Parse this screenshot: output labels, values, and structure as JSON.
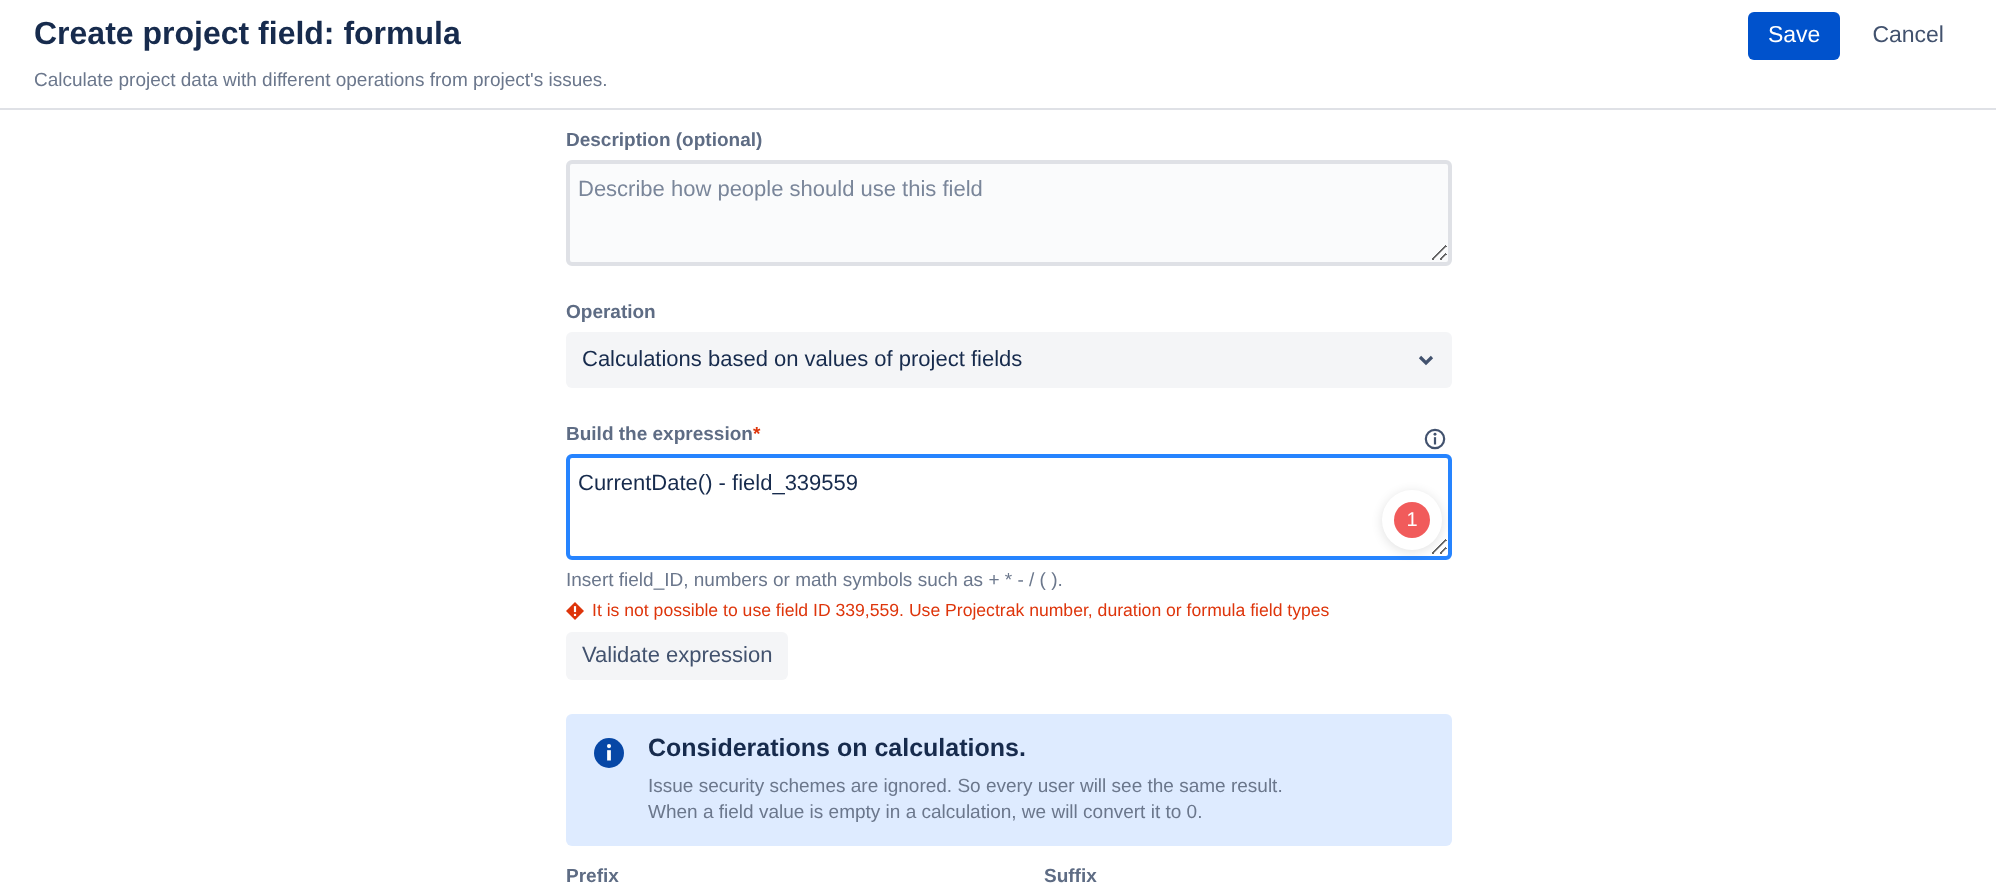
{
  "header": {
    "title": "Create project field: formula",
    "subtitle": "Calculate project data with different operations from project's issues.",
    "buttons": [
      {
        "label": "Save",
        "kind": "primary"
      },
      {
        "label": "Cancel",
        "kind": "subtle"
      }
    ]
  },
  "description": {
    "label": "Description (optional)",
    "placeholder": "Describe how people should use this field"
  },
  "operation": {
    "label": "Operation",
    "value": "Calculations based on values of project fields"
  },
  "expression": {
    "label": "Build the expression",
    "required_mark": "*",
    "value": "CurrentDate() - field_339559",
    "badge": "1",
    "hint": "Insert field_ID, numbers or math symbols such as + * - / ( ).",
    "error": "It is not possible to use field ID 339,559. Use Projectrak number, duration or formula field types",
    "button": "Validate expression"
  },
  "info": {
    "title": "Considerations on calculations.",
    "lines": [
      "Issue security schemes are ignored. So every user will see the same result.",
      "When a field value is empty in a calculation, we will convert it to 0."
    ]
  },
  "bottom_labels": [
    "Prefix",
    "Suffix"
  ]
}
